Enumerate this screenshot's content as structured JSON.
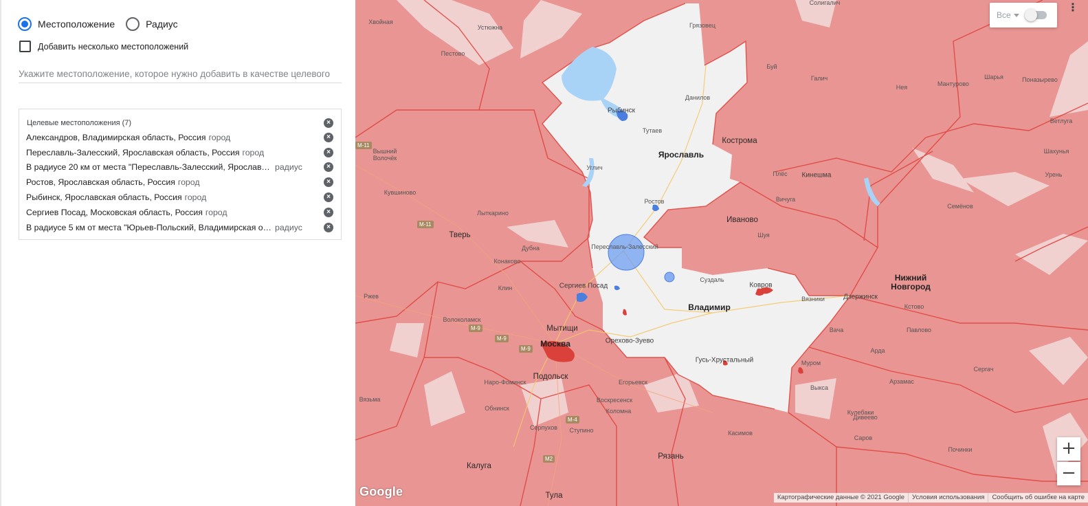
{
  "panel": {
    "radio_location": "Местоположение",
    "radio_radius": "Радиус",
    "add_multiple": "Добавить несколько местоположений",
    "search_placeholder": "Укажите местоположение, которое нужно добавить в качестве целевого",
    "targets_header": "Целевые местоположения (7)",
    "targets": [
      {
        "name": "Александров, Владимирская область, Россия",
        "type": "город"
      },
      {
        "name": "Переславль-Залесский, Ярославская область, Россия",
        "type": "город"
      },
      {
        "name": "В радиусе 20 км от места \"Переславль-Залесский, Ярославская обл...",
        "type": "радиус"
      },
      {
        "name": "Ростов, Ярославская область, Россия",
        "type": "город"
      },
      {
        "name": "Рыбинск, Ярославская область, Россия",
        "type": "город"
      },
      {
        "name": "Сергиев Посад, Московская область, Россия",
        "type": "город"
      },
      {
        "name": "В радиусе 5 км от места \"Юрьев-Польский, Владимирская обла...",
        "type": "радиус"
      }
    ],
    "remove_glyph": "×"
  },
  "map": {
    "filter_label": "Все",
    "zoom_in": "+",
    "zoom_out": "−",
    "google_logo": "Google",
    "footer": {
      "map_data": "Картографические данные © 2021 Google",
      "terms": "Условия использования",
      "report": "Сообщить об ошибке на карте"
    },
    "labels": {
      "yaroslavl": "Ярославль",
      "kostroma": "Кострома",
      "rybinsk": "Рыбинск",
      "danilov": "Данилов",
      "uglich": "Углич",
      "rostov": "Ростов",
      "ivanovo": "Иваново",
      "shuya": "Шуя",
      "tver": "Тверь",
      "klin": "Клин",
      "sergiev_posad": "Сергиев Посад",
      "pereslavl": "Переславль-Залесский",
      "mytishchi": "Мытищи",
      "moscow": "Москва",
      "podolsk": "Подольск",
      "vladimir": "Владимир",
      "kovrov": "Ковров",
      "suzdal": "Суздаль",
      "vyazniki": "Вязники",
      "murom": "Муром",
      "gus": "Гусь-Хрустальный",
      "orekhovo": "Орехово-Зуево",
      "egorievsk": "Егорьевск",
      "voskresensk": "Воскресенск",
      "kolomna": "Коломна",
      "serpukhov": "Серпухов",
      "stupino": "Ступино",
      "ryazan": "Рязань",
      "kaluga": "Калуга",
      "tula": "Тула",
      "obninsk": "Обнинск",
      "naro_fominsk": "Наро-Фоминск",
      "vyazma": "Вязьма",
      "rzhev": "Ржев",
      "volokolamsk": "Волоколамск",
      "dubna": "Дубна",
      "konakovo": "Конаково",
      "vyshny": "Вышний\nВолочёк",
      "nizhny": "Нижний\nНовгород",
      "dzerzhinsk": "Дзержинск",
      "kstovo": "Кстово",
      "arzamas": "Арзамас",
      "vyksa": "Выкса",
      "kineshma": "Кинешма",
      "vichuga": "Вичуга",
      "sergach": "Сергач",
      "sarov": "Саров",
      "divееvo": "Дивеево",
      "pochinki": "Починки",
      "buy": "Буй",
      "galich": "Галич",
      "neya": "Нея",
      "manturovo": "Мантурово",
      "sharya": "Шарья",
      "ponazyrevo": "Поназырево",
      "vetluga": "Ветлуга",
      "shakhunya": "Шахунья",
      "uren": "Урень",
      "ples": "Плёс",
      "khvoynaya": "Хвойная",
      "ustyuzhna": "Устюжна",
      "pestovo": "Пестово",
      "gryazovets": "Грязовец",
      "soligalich": "Солигалич",
      "kuvshinovo": "Кувшиново",
      "tutaev": "Тутаев",
      "kulebaki": "Кулебаки",
      "vykhino": "Лыткарино",
      "pavlovo": "Павлово",
      "semenov": "Семёнов",
      "ardatov": "Арда",
      "vacha": "Вача",
      "kasimov": "Касимов"
    },
    "roads": [
      "M-11",
      "M-11",
      "M-9",
      "M-9",
      "M-9",
      "M-4",
      "M2"
    ]
  }
}
